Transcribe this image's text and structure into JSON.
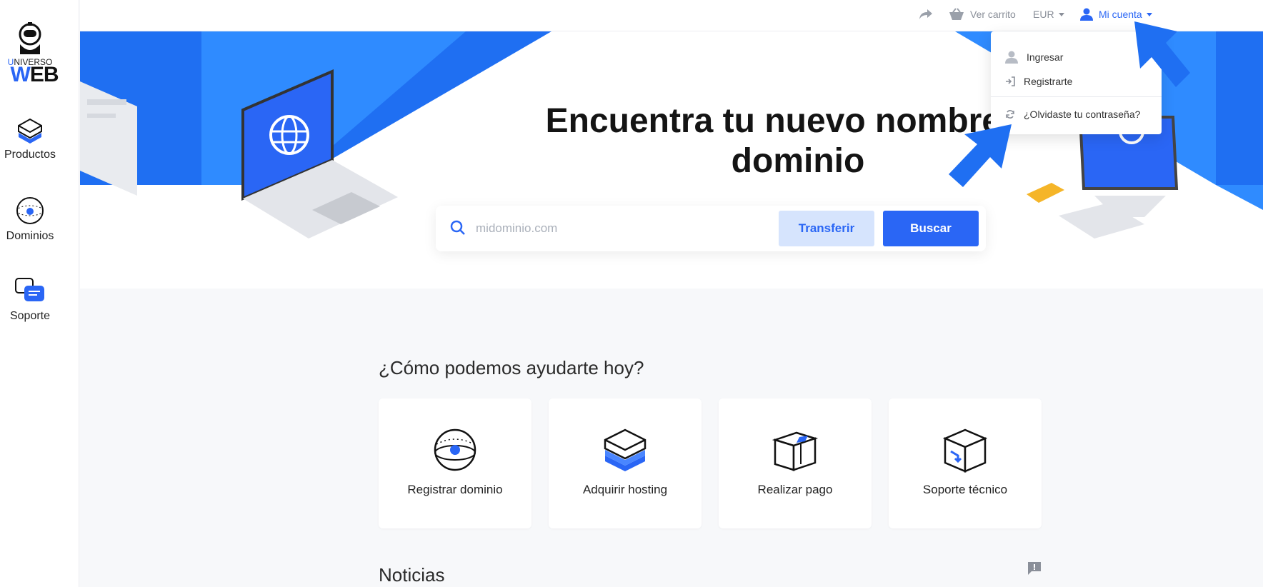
{
  "brand": {
    "name_top": "UNIVERSO",
    "name_bottom": "WEB"
  },
  "sidebar": {
    "items": [
      {
        "label": "Productos",
        "icon": "server-stack-icon"
      },
      {
        "label": "Dominios",
        "icon": "globe-icon"
      },
      {
        "label": "Soporte",
        "icon": "chat-bubbles-icon"
      }
    ]
  },
  "topbar": {
    "cart_label": "Ver carrito",
    "currency_label": "EUR",
    "account_label": "Mi cuenta"
  },
  "dropdown": {
    "items": [
      {
        "label": "Ingresar",
        "icon": "user-icon"
      },
      {
        "label": "Registrarte",
        "icon": "sign-in-icon"
      },
      {
        "label": "¿Olvidaste tu contraseña?",
        "icon": "refresh-icon"
      }
    ]
  },
  "hero": {
    "title": "Encuentra tu nuevo nombre de dominio",
    "search_placeholder": "midominio.com",
    "transfer_label": "Transferir",
    "search_label": "Buscar"
  },
  "help": {
    "title": "¿Cómo podemos ayudarte hoy?",
    "cards": [
      {
        "label": "Registrar dominio",
        "icon": "domain-globe-icon"
      },
      {
        "label": "Adquirir hosting",
        "icon": "hosting-server-icon"
      },
      {
        "label": "Realizar pago",
        "icon": "payment-box-icon"
      },
      {
        "label": "Soporte técnico",
        "icon": "support-box-icon"
      }
    ]
  },
  "news": {
    "title": "Noticias"
  },
  "colors": {
    "accent": "#2a66f5",
    "accent_light": "#d6e4fd",
    "hero_blue": "#2f8bff"
  }
}
